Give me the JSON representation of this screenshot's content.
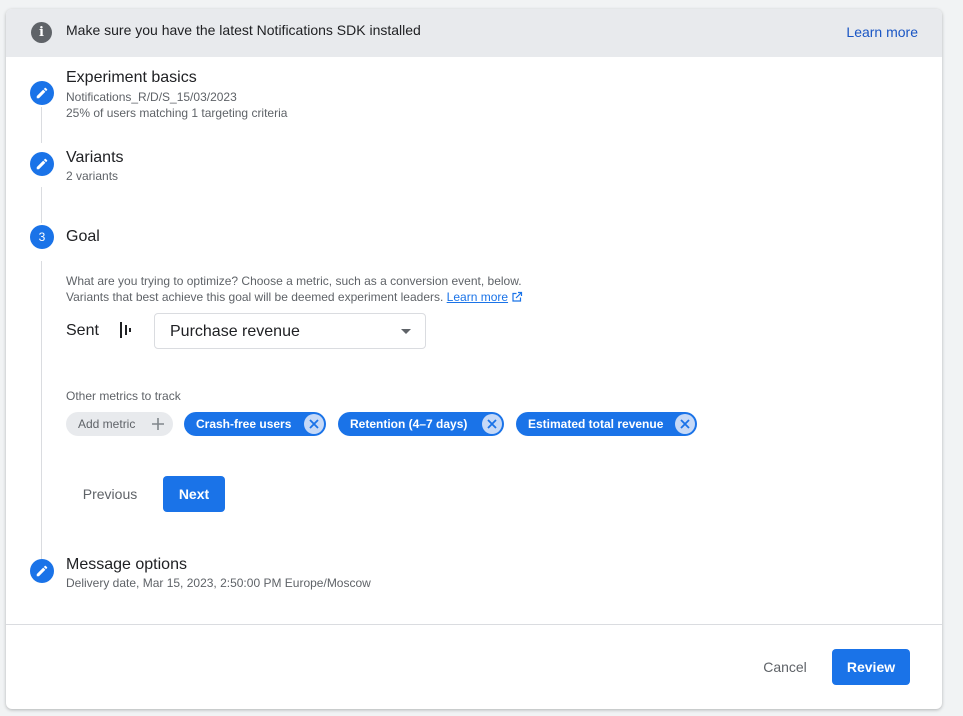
{
  "banner": {
    "info_icon_glyph": "i",
    "message": "Make sure you have the latest Notifications SDK installed",
    "learn_more": "Learn more"
  },
  "steps": [
    {
      "icon": "pencil-icon",
      "title": "Experiment basics",
      "subtitles": [
        "Notifications_R/D/S_15/03/2023",
        "25% of users matching 1 targeting criteria"
      ]
    },
    {
      "icon": "pencil-icon",
      "title": "Variants",
      "subtitles": [
        "2 variants"
      ]
    },
    {
      "number": "3",
      "title": "Goal"
    },
    {
      "icon": "pencil-icon",
      "title": "Message options",
      "subtitles": [
        "Delivery date, Mar 15, 2023, 2:50:00 PM Europe/Moscow"
      ]
    }
  ],
  "goal": {
    "description_line1": "What are you trying to optimize? Choose a metric, such as a conversion event, below.",
    "description_line2": "Variants that best achieve this goal will be deemed experiment leaders.",
    "learn_more": "Learn more",
    "sent_label": "Sent",
    "selected_metric": "Purchase revenue",
    "other_metrics_label": "Other metrics to track",
    "add_metric_label": "Add metric",
    "metric_chips": [
      "Crash-free users",
      "Retention (4–7 days)",
      "Estimated total revenue"
    ],
    "previous_label": "Previous",
    "next_label": "Next"
  },
  "footer": {
    "cancel_label": "Cancel",
    "review_label": "Review"
  },
  "colors": {
    "accent": "#1a73e8",
    "banner_bg": "#e8eaed",
    "chip_close_bg": "#c6d9f7"
  }
}
